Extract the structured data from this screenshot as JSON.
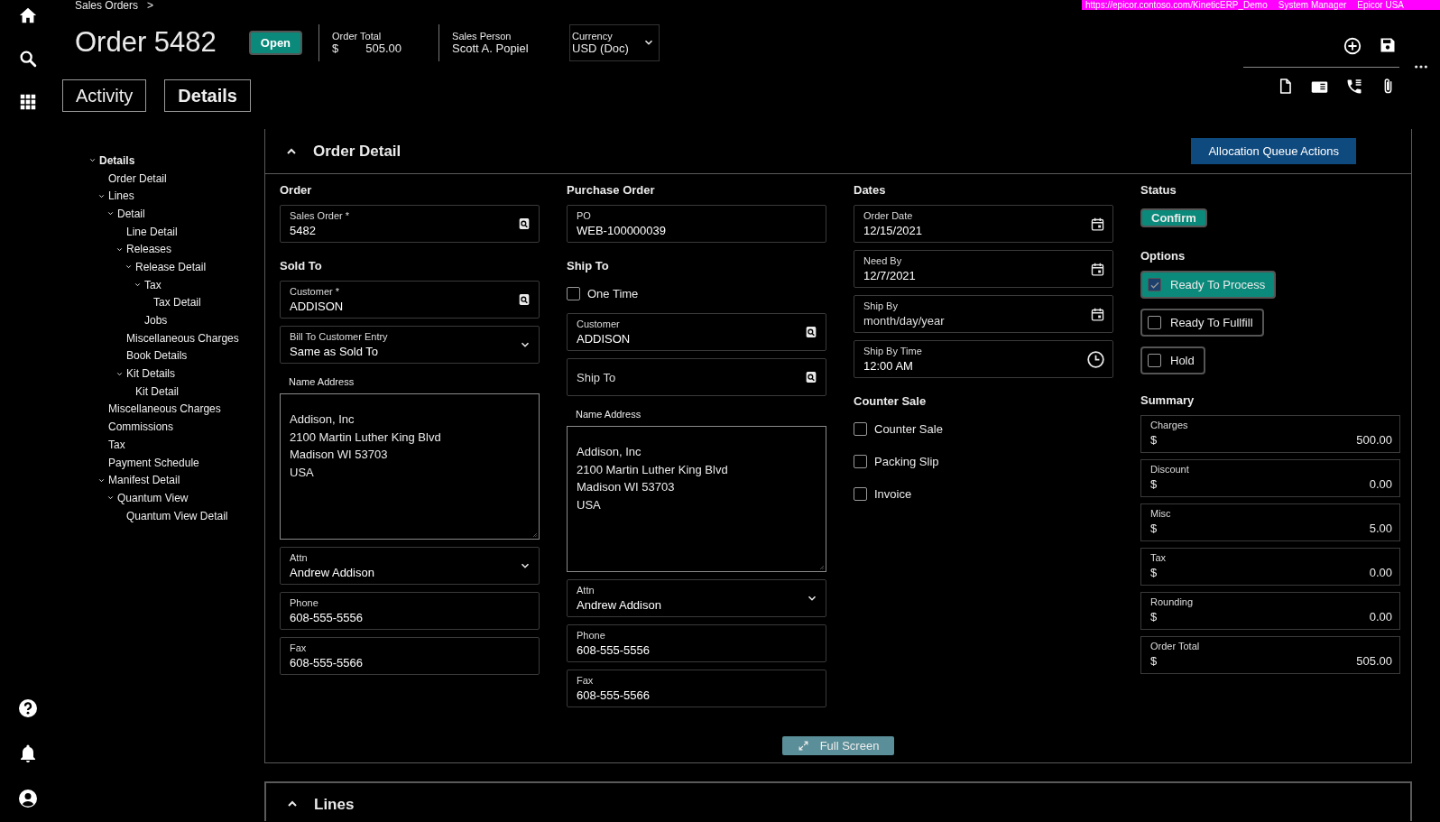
{
  "environment_banner": {
    "url": "https://epicor.contoso.com/KineticERP_Demo",
    "user": "System Manager",
    "company": "Epicor USA"
  },
  "breadcrumb": {
    "label": "Sales Orders",
    "separator": ">"
  },
  "header": {
    "title": "Order 5482",
    "status_badge": "Open",
    "summary": [
      {
        "label": "Order Total",
        "currency": "$",
        "value": "505.00"
      },
      {
        "label": "Sales Person",
        "value": "Scott A. Popiel"
      }
    ],
    "currency": {
      "label": "Currency",
      "value": "USD (Doc)"
    }
  },
  "tabs": [
    {
      "label": "Activity",
      "selected": false
    },
    {
      "label": "Details",
      "selected": true
    }
  ],
  "tree": [
    {
      "label": "Details",
      "expanded": true,
      "children": [
        {
          "label": "Order Detail"
        },
        {
          "label": "Lines",
          "expanded": true,
          "children": [
            {
              "label": "Detail",
              "expanded": true,
              "children": [
                {
                  "label": "Line Detail"
                },
                {
                  "label": "Releases",
                  "expanded": true,
                  "children": [
                    {
                      "label": "Release Detail",
                      "expanded": true,
                      "children": [
                        {
                          "label": "Tax",
                          "expanded": true,
                          "children": [
                            {
                              "label": "Tax Detail"
                            }
                          ]
                        },
                        {
                          "label": "Jobs"
                        }
                      ]
                    }
                  ]
                },
                {
                  "label": "Miscellaneous Charges"
                },
                {
                  "label": "Book Details"
                },
                {
                  "label": "Kit Details",
                  "expanded": true,
                  "children": [
                    {
                      "label": "Kit Detail"
                    }
                  ]
                }
              ]
            }
          ]
        },
        {
          "label": "Miscellaneous Charges"
        },
        {
          "label": "Commissions"
        },
        {
          "label": "Tax"
        },
        {
          "label": "Payment Schedule"
        },
        {
          "label": "Manifest Detail",
          "expanded": true,
          "children": [
            {
              "label": "Quantum View",
              "expanded": true,
              "children": [
                {
                  "label": "Quantum View Detail"
                }
              ]
            }
          ]
        }
      ]
    }
  ],
  "order_detail": {
    "title": "Order Detail",
    "expanded": true,
    "action_button": "Allocation Queue Actions",
    "columns": [
      {
        "items": [
          {
            "kind": "heading",
            "label": "Order"
          },
          {
            "kind": "lookup",
            "label": "Sales Order *",
            "value": "5482"
          },
          {
            "kind": "heading",
            "label": "Sold To"
          },
          {
            "kind": "lookup",
            "label": "Customer *",
            "value": "ADDISON"
          },
          {
            "kind": "dropdown",
            "label": "Bill To Customer Entry",
            "value": "Same as Sold To"
          },
          {
            "kind": "address",
            "label": "Name Address",
            "value": "Addison, Inc\n2100 Martin Luther King Blvd\nMadison WI 53703\nUSA"
          },
          {
            "kind": "dropdown",
            "label": "Attn",
            "value": "Andrew Addison"
          },
          {
            "kind": "text",
            "label": "Phone",
            "value": "608-555-5556"
          },
          {
            "kind": "text",
            "label": "Fax",
            "value": "608-555-5566"
          }
        ]
      },
      {
        "items": [
          {
            "kind": "heading",
            "label": "Purchase Order"
          },
          {
            "kind": "text",
            "label": "PO",
            "value": "WEB-100000039"
          },
          {
            "kind": "heading",
            "label": "Ship To"
          },
          {
            "kind": "checkbox",
            "label": "One Time",
            "checked": false
          },
          {
            "kind": "lookup",
            "label": "Customer",
            "value": "ADDISON"
          },
          {
            "kind": "lookup",
            "label": "Ship To"
          },
          {
            "kind": "address",
            "label": "Name Address",
            "value": "Addison, Inc\n2100 Martin Luther King Blvd\nMadison WI 53703\nUSA"
          },
          {
            "kind": "dropdown",
            "label": "Attn",
            "value": "Andrew Addison"
          },
          {
            "kind": "text",
            "label": "Phone",
            "value": "608-555-5556"
          },
          {
            "kind": "text",
            "label": "Fax",
            "value": "608-555-5566"
          }
        ]
      },
      {
        "items": [
          {
            "kind": "heading",
            "label": "Dates"
          },
          {
            "kind": "date",
            "label": "Order Date",
            "value": "12/15/2021"
          },
          {
            "kind": "date",
            "label": "Need By",
            "value": "12/7/2021"
          },
          {
            "kind": "date",
            "label": "Ship By",
            "placeholder": "month/day/year"
          },
          {
            "kind": "time",
            "label": "Ship By Time",
            "value": "12:00 AM"
          },
          {
            "kind": "heading",
            "label": "Counter Sale"
          },
          {
            "kind": "checkbox",
            "label": "Counter Sale",
            "checked": false
          },
          {
            "kind": "checkbox",
            "label": "Packing Slip",
            "checked": false
          },
          {
            "kind": "checkbox",
            "label": "Invoice",
            "checked": false
          }
        ]
      },
      {
        "items": [
          {
            "kind": "heading",
            "label": "Status"
          },
          {
            "kind": "badge",
            "label": "Confirm"
          },
          {
            "kind": "heading",
            "label": "Options"
          },
          {
            "kind": "option",
            "label": "Ready To Process",
            "checked": true
          },
          {
            "kind": "option",
            "label": "Ready To Fullfill",
            "checked": false
          },
          {
            "kind": "option",
            "label": "Hold",
            "checked": false
          },
          {
            "kind": "heading",
            "label": "Summary"
          },
          {
            "kind": "money",
            "label": "Charges",
            "currency": "$",
            "value": "500.00"
          },
          {
            "kind": "money",
            "label": "Discount",
            "currency": "$",
            "value": "0.00"
          },
          {
            "kind": "money",
            "label": "Misc",
            "currency": "$",
            "value": "5.00"
          },
          {
            "kind": "money",
            "label": "Tax",
            "currency": "$",
            "value": "0.00"
          },
          {
            "kind": "money",
            "label": "Rounding",
            "currency": "$",
            "value": "0.00"
          },
          {
            "kind": "money",
            "label": "Order Total",
            "currency": "$",
            "value": "505.00"
          }
        ]
      }
    ],
    "full_screen_button": "Full Screen"
  },
  "lines_panel": {
    "title": "Lines",
    "expanded": true
  }
}
